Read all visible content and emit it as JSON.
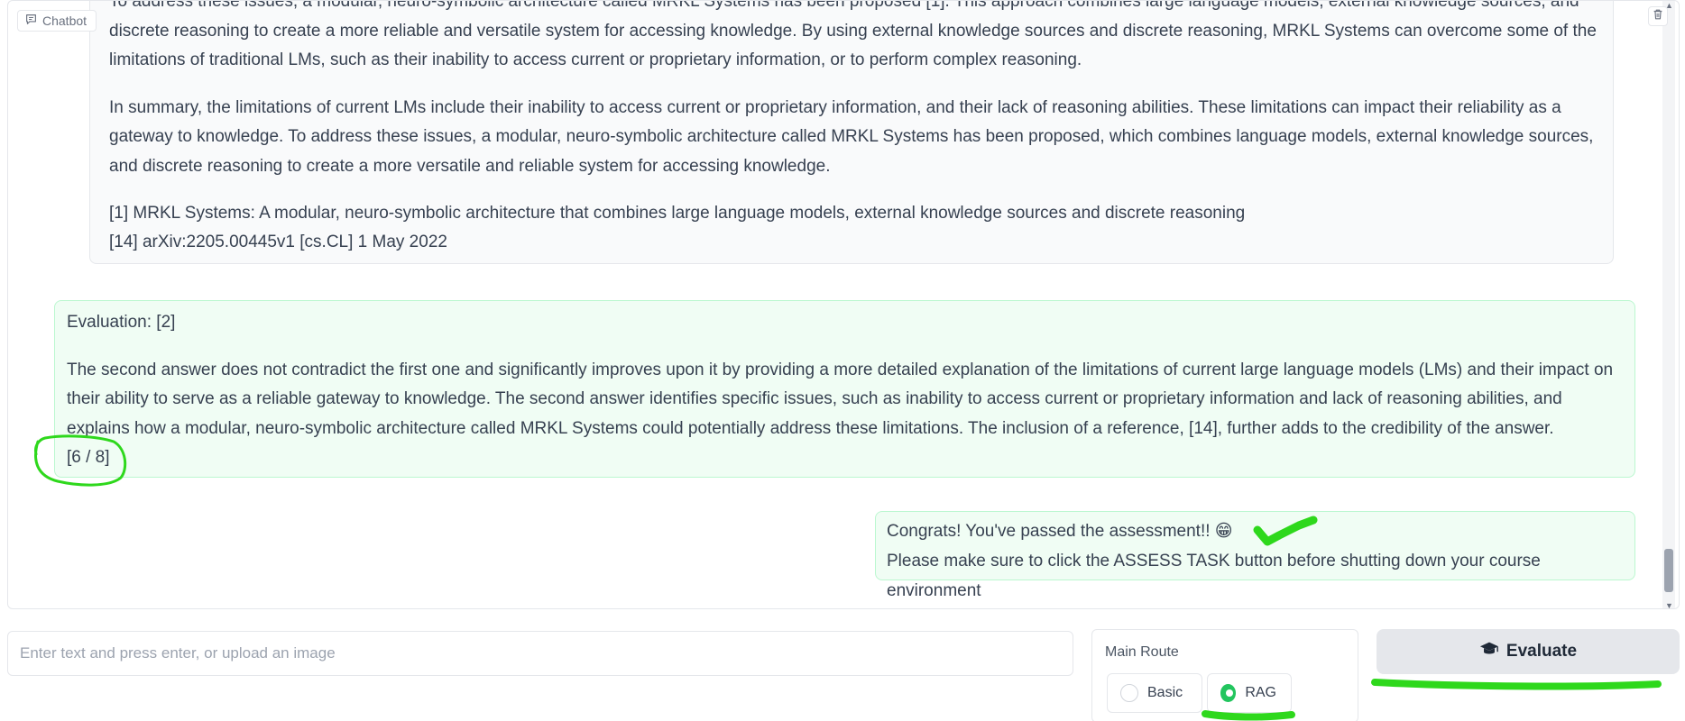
{
  "chatbot": {
    "label": "Chatbot",
    "label_icon": "chat-icon",
    "trash_icon": "trash-icon"
  },
  "messages": {
    "bot": {
      "para1": "To address these issues, a modular, neuro-symbolic architecture called MRKL Systems has been proposed [1]. This approach combines large language models, external knowledge sources, and discrete reasoning to create a more reliable and versatile system for accessing knowledge. By using external knowledge sources and discrete reasoning, MRKL Systems can overcome some of the limitations of traditional LMs, such as their inability to access current or proprietary information, or to perform complex reasoning.",
      "para2": "In summary, the limitations of current LMs include their inability to access current or proprietary information, and their lack of reasoning abilities. These limitations can impact their reliability as a gateway to knowledge. To address these issues, a modular, neuro-symbolic architecture called MRKL Systems has been proposed, which combines language models, external knowledge sources, and discrete reasoning to create a more versatile and reliable system for accessing knowledge.",
      "ref1": "[1] MRKL Systems: A modular, neuro-symbolic architecture that combines large language models, external knowledge sources and discrete reasoning",
      "ref2": "[14] arXiv:2205.00445v1 [cs.CL] 1 May 2022"
    },
    "evaluation": {
      "title": "Evaluation: [2]",
      "body": "The second answer does not contradict the first one and significantly improves upon it by providing a more detailed explanation of the limitations of current large language models (LMs) and their impact on their ability to serve as a reliable gateway to knowledge. The second answer identifies specific issues, such as inability to access current or proprietary information and lack of reasoning abilities, and explains how a modular, neuro-symbolic architecture called MRKL Systems could potentially address these limitations. The inclusion of a reference, [14], further adds to the credibility of the answer.",
      "score": "[6 / 8]"
    },
    "user": {
      "line1": "Congrats! You've passed the assessment!! 😁",
      "line2": "Please make sure to click the ASSESS TASK button before shutting down your course environment"
    }
  },
  "input": {
    "placeholder": "Enter text and press enter, or upload an image"
  },
  "route": {
    "title": "Main Route",
    "options": [
      "Basic",
      "RAG"
    ],
    "selected": "RAG"
  },
  "evaluate_button": {
    "label": "Evaluate",
    "icon": "graduation-cap-icon"
  },
  "colors": {
    "accent_green": "#22c55e",
    "annotation_green": "#2ed81c",
    "message_green_bg": "#f0fdf4",
    "message_green_border": "#bbf7d0"
  }
}
